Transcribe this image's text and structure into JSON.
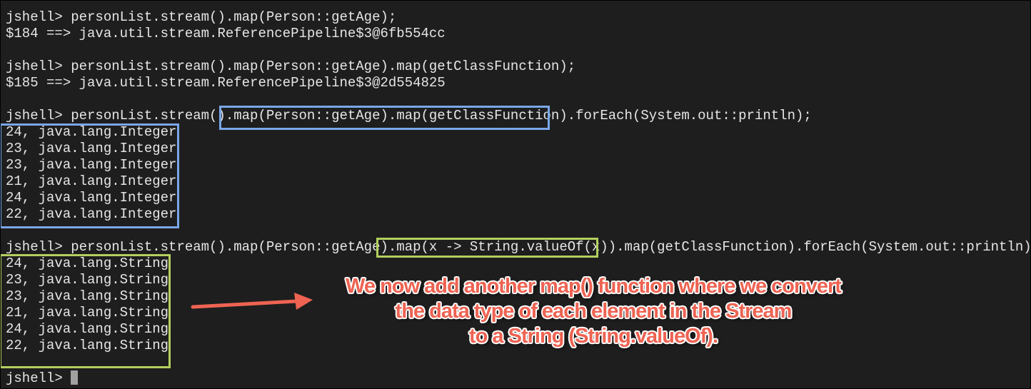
{
  "terminal": {
    "lines": [
      "jshell> personList.stream().map(Person::getAge);",
      "$184 ==> java.util.stream.ReferencePipeline$3@6fb554cc",
      "",
      "jshell> personList.stream().map(Person::getAge).map(getClassFunction);",
      "$185 ==> java.util.stream.ReferencePipeline$3@2d554825",
      "",
      "jshell> personList.stream().map(Person::getAge).map(getClassFunction).forEach(System.out::println);",
      "24, java.lang.Integer",
      "23, java.lang.Integer",
      "23, java.lang.Integer",
      "21, java.lang.Integer",
      "24, java.lang.Integer",
      "22, java.lang.Integer",
      "",
      "jshell> personList.stream().map(Person::getAge).map(x -> String.valueOf(x)).map(getClassFunction).forEach(System.out::println);",
      "24, java.lang.String",
      "23, java.lang.String",
      "23, java.lang.String",
      "21, java.lang.String",
      "24, java.lang.String",
      "22, java.lang.String",
      "",
      "jshell> "
    ]
  },
  "annotation": {
    "line1": "We now add another map() function where we convert",
    "line2": "the data type of each element in the Stream",
    "line3": "to a String (String.valueOf)."
  },
  "colors": {
    "highlight_blue": "#7aa7e8",
    "highlight_green": "#b3cf5f",
    "annotation": "#ee6352"
  }
}
